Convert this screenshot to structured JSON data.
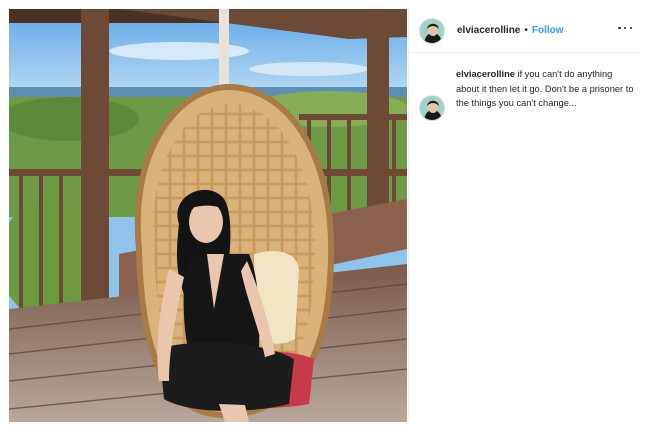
{
  "post": {
    "username": "elviacerolline",
    "separator": "•",
    "follow_label": "Follow",
    "more_icon": "more-options-icon",
    "caption": {
      "username": "elviacerolline",
      "text": " if you can't do anything about it then let it go. Don't be a prisoner to the things you can't change..."
    }
  },
  "colors": {
    "follow_blue": "#3897f0",
    "divider": "#efefef"
  }
}
